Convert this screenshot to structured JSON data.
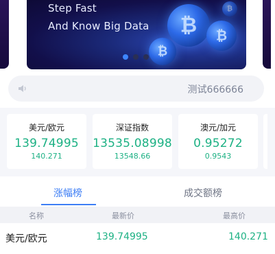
{
  "banner": {
    "line1": "Step Fast",
    "line2": "And Know Big Data",
    "coin_symbol": "₿",
    "slides": 3,
    "active_slide": 1
  },
  "notice": {
    "icon": "speaker-icon",
    "text": "测试666666"
  },
  "tickers": [
    {
      "name": "美元/欧元",
      "price": "139.74995",
      "high": "140.271"
    },
    {
      "name": "深证指数",
      "price": "13535.08998",
      "high": "13548.66"
    },
    {
      "name": "澳元/加元",
      "price": "0.95272",
      "high": "0.9543"
    }
  ],
  "tabs": [
    {
      "label": "涨幅榜",
      "active": true
    },
    {
      "label": "成交额榜",
      "active": false
    }
  ],
  "table": {
    "headers": {
      "name": "名称",
      "latest": "最新价",
      "high": "最高价"
    },
    "rows": [
      {
        "name": "美元/欧元",
        "latest": "139.74995",
        "high": "140.271"
      }
    ]
  },
  "colors": {
    "accent": "#3d7ef5",
    "up": "#1db184",
    "active_dot": "#3d86ff"
  }
}
